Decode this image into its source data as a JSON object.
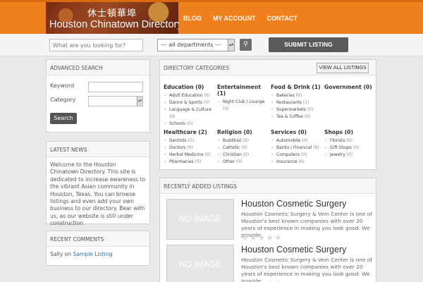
{
  "site": {
    "logo_chinese": "休士頓華埠",
    "logo_title": "Houston Chinatown Directory"
  },
  "nav": {
    "items": [
      "BLOG",
      "MY ACCOUNT",
      "CONTACT"
    ]
  },
  "search": {
    "placeholder": "What are you looking for?",
    "department": "--- all departments ---",
    "submit_label": "SUBMIT LISTING"
  },
  "advanced": {
    "title": "ADVANCED SEARCH",
    "keyword_label": "Keyword",
    "category_label": "Category",
    "button": "Search"
  },
  "news": {
    "title": "LATEST NEWS",
    "text": "Welcome to the Houston Chinatown Directory. This site is dedicated to increase awareness to the vibrant Asian community in Houston, Texas. You can browse listings and even add your own business to our directory. Bear with us, as our website is still under construction"
  },
  "comments": {
    "title": "RECENT COMMENTS",
    "author": "Sally",
    "on": "on",
    "post": "Sample Listing"
  },
  "categories": {
    "title": "DIRECTORY CATEGORIES",
    "view_all": "VIEW ALL LISTINGS",
    "groups": [
      {
        "name": "Education (0)",
        "items": [
          [
            "Adult Education",
            "(0)"
          ],
          [
            "Dance & Sports",
            "(0)"
          ],
          [
            "Language & Culture",
            "(0)"
          ],
          [
            "Schools",
            "(0)"
          ]
        ]
      },
      {
        "name": "Entertainment (1)",
        "items": [
          [
            "Night Club / Lounge",
            "(0)"
          ]
        ]
      },
      {
        "name": "Food & Drink (1)",
        "items": [
          [
            "Bakeries",
            "(0)"
          ],
          [
            "Restaurants",
            "(1)"
          ],
          [
            "Supermarkets",
            "(0)"
          ],
          [
            "Tea & Coffee",
            "(0)"
          ]
        ]
      },
      {
        "name": "Government (0)",
        "items": []
      },
      {
        "name": "Healthcare (2)",
        "items": [
          [
            "Dentists",
            "(0)"
          ],
          [
            "Doctors",
            "(0)"
          ],
          [
            "Herbal Medicine",
            "(0)"
          ],
          [
            "Pharmacies",
            "(0)"
          ]
        ]
      },
      {
        "name": "Religion (0)",
        "items": [
          [
            "Buddhist",
            "(0)"
          ],
          [
            "Catholic",
            "(0)"
          ],
          [
            "Christian",
            "(0)"
          ],
          [
            "Other",
            "(0)"
          ]
        ]
      },
      {
        "name": "Services (0)",
        "items": [
          [
            "Automobile",
            "(0)"
          ],
          [
            "Banks / Financial",
            "(0)"
          ],
          [
            "Computers",
            "(0)"
          ],
          [
            "Insurance",
            "(0)"
          ]
        ]
      },
      {
        "name": "Shops (0)",
        "items": [
          [
            "Florists",
            "(0)"
          ],
          [
            "Gift Shops",
            "(0)"
          ],
          [
            "Jewelry",
            "(0)"
          ]
        ]
      }
    ]
  },
  "recent": {
    "title": "RECENTLY ADDED LISTINGS",
    "listings": [
      {
        "image_text": "NO IMAGE",
        "title": "Houston Cosmetic Surgery",
        "description": "Houston Cosmetic Surgery & Vein Center is one of Houston's best known companies with over 20 years of experience in making you look good. We provide",
        "rating": 0,
        "max_rating": 5
      },
      {
        "image_text": "NO IMAGE",
        "title": "Houston Cosmetic Surgery",
        "description": "Houston Cosmetic Surgery & Vein Center is one of Houston's best known companies with over 20 years of experience in making you look good. We provide",
        "rating": 0,
        "max_rating": 5
      }
    ]
  },
  "colors": {
    "accent": "#f0801c",
    "accent_dark": "#d96a0d",
    "button": "#5a5a5a",
    "link": "#2a6fb0"
  },
  "icons": {
    "search_button": "search-icon",
    "select_arrow": "arrow-updown-icon",
    "rating": "star-icon"
  }
}
